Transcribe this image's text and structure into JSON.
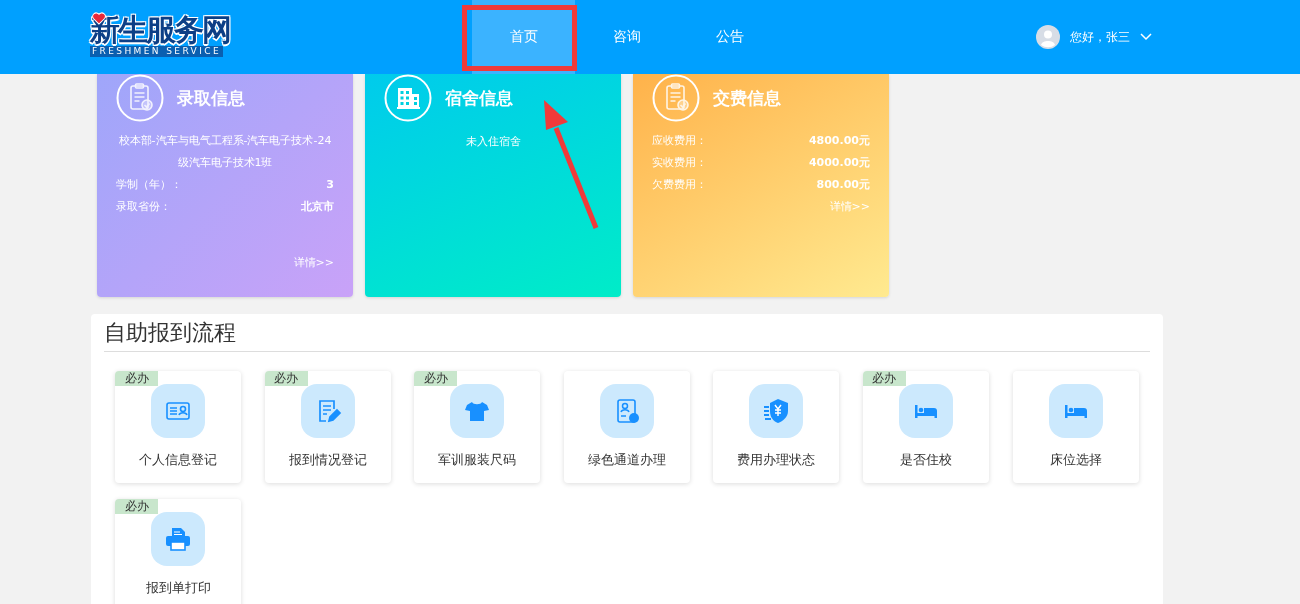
{
  "header": {
    "logo": {
      "title": "新生服务网",
      "subtitle": "FRESHMEN SERVICE"
    },
    "nav": [
      {
        "label": "首页",
        "selected": true
      },
      {
        "label": "咨询",
        "selected": false
      },
      {
        "label": "公告",
        "selected": false
      }
    ],
    "user": {
      "greeting": "您好，张三"
    }
  },
  "cards": [
    {
      "kind": "admission",
      "title": "录取信息",
      "description": "校本部-汽车与电气工程系-汽车电子技术-24级汽车电子技术1班",
      "rows": [
        {
          "label": "学制（年）：",
          "value": "3"
        },
        {
          "label": "录取省份：",
          "value": "北京市"
        }
      ],
      "link": "详情>>"
    },
    {
      "kind": "dorm",
      "title": "宿舍信息",
      "note": "未入住宿舍"
    },
    {
      "kind": "fee",
      "title": "交费信息",
      "rows": [
        {
          "label": "应收费用：",
          "value": "4800.00元"
        },
        {
          "label": "实收费用：",
          "value": "4000.00元"
        },
        {
          "label": "欠费费用：",
          "value": "800.00元"
        }
      ],
      "link": "详情>>"
    }
  ],
  "process": {
    "title": "自助报到流程",
    "steps": [
      {
        "label": "个人信息登记",
        "kind": "id-card",
        "badge": "必办"
      },
      {
        "label": "报到情况登记",
        "kind": "form",
        "badge": "必办"
      },
      {
        "label": "军训服装尺码",
        "kind": "shirt",
        "badge": "必办"
      },
      {
        "label": "绿色通道办理",
        "kind": "profile"
      },
      {
        "label": "费用办理状态",
        "kind": "yuan"
      },
      {
        "label": "是否住校",
        "kind": "bed",
        "badge": "必办"
      },
      {
        "label": "床位选择",
        "kind": "bed"
      },
      {
        "label": "报到单打印",
        "kind": "printer",
        "badge": "必办"
      }
    ]
  }
}
